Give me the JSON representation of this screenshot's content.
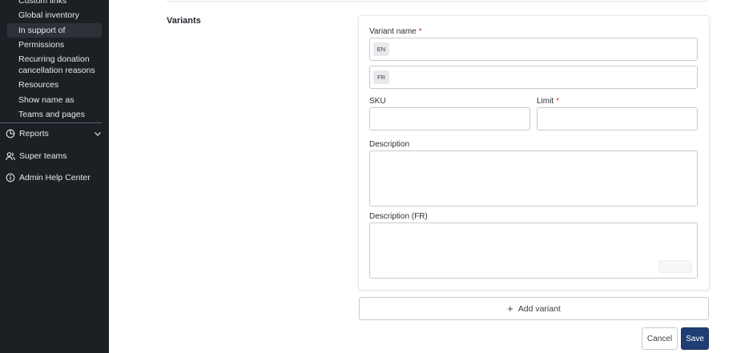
{
  "sidebar": {
    "sub_items": [
      {
        "label": "Custom links"
      },
      {
        "label": "Global inventory"
      },
      {
        "label": "In support of"
      },
      {
        "label": "Permissions"
      },
      {
        "label": "Recurring donation cancellation reasons"
      },
      {
        "label": "Resources"
      },
      {
        "label": "Show name as"
      },
      {
        "label": "Teams and pages"
      }
    ],
    "nav": {
      "reports": {
        "label": "Reports",
        "icon": "pie-chart-icon"
      },
      "super_teams": {
        "label": "Super teams",
        "icon": "users-icon"
      },
      "help_center": {
        "label": "Admin Help Center",
        "icon": "info-icon"
      }
    }
  },
  "section": {
    "title": "Variants"
  },
  "variant": {
    "name_label": "Variant name",
    "required_mark": "*",
    "lang_en": "EN",
    "lang_fr": "FR",
    "sku_label": "SKU",
    "limit_label": "Limit",
    "description_label": "Description",
    "description_fr_label": "Description (FR)"
  },
  "actions": {
    "add_variant": "Add variant",
    "cancel": "Cancel",
    "save": "Save"
  },
  "colors": {
    "sidebar_bg": "#1c1f24",
    "primary": "#1f3e73",
    "required": "#d0312d"
  }
}
